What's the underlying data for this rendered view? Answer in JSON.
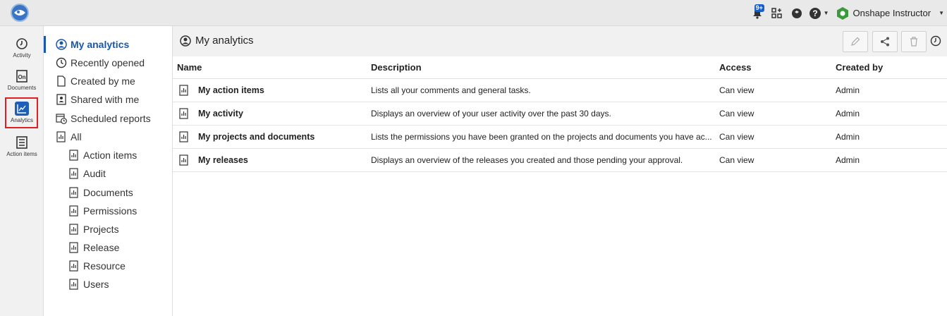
{
  "topbar": {
    "notification_badge": "9+",
    "user_name": "Onshape Instructor"
  },
  "rail": {
    "items": [
      {
        "label": "Activity",
        "icon": "clock-icon"
      },
      {
        "label": "Documents",
        "icon": "document-icon"
      },
      {
        "label": "Analytics",
        "icon": "analytics-icon"
      },
      {
        "label": "Action items",
        "icon": "checklist-icon"
      }
    ]
  },
  "nav": {
    "items": [
      {
        "label": "My analytics",
        "icon": "user-circle-icon"
      },
      {
        "label": "Recently opened",
        "icon": "clock-icon"
      },
      {
        "label": "Created by me",
        "icon": "file-icon"
      },
      {
        "label": "Shared with me",
        "icon": "shared-user-icon"
      },
      {
        "label": "Scheduled reports",
        "icon": "calendar-clock-icon"
      },
      {
        "label": "All",
        "icon": "report-icon"
      },
      {
        "label": "Action items",
        "icon": "report-icon"
      },
      {
        "label": "Audit",
        "icon": "report-icon"
      },
      {
        "label": "Documents",
        "icon": "report-icon"
      },
      {
        "label": "Permissions",
        "icon": "report-icon"
      },
      {
        "label": "Projects",
        "icon": "report-icon"
      },
      {
        "label": "Release",
        "icon": "report-icon"
      },
      {
        "label": "Resource",
        "icon": "report-icon"
      },
      {
        "label": "Users",
        "icon": "report-icon"
      }
    ]
  },
  "main": {
    "title": "My analytics",
    "columns": [
      "Name",
      "Description",
      "Access",
      "Created by"
    ],
    "rows": [
      {
        "name": "My action items",
        "description": "Lists all your comments and general tasks.",
        "access": "Can view",
        "created_by": "Admin"
      },
      {
        "name": "My activity",
        "description": "Displays an overview of your user activity over the past 30 days.",
        "access": "Can view",
        "created_by": "Admin"
      },
      {
        "name": "My projects and documents",
        "description": "Lists the permissions you have been granted on the projects and documents you have ac...",
        "access": "Can view",
        "created_by": "Admin"
      },
      {
        "name": "My releases",
        "description": "Displays an overview of the releases you created and those pending your approval.",
        "access": "Can view",
        "created_by": "Admin"
      }
    ]
  },
  "colors": {
    "accent": "#1a56b0",
    "highlight_box": "#e02020",
    "onshape_green": "#3c9a3c"
  }
}
